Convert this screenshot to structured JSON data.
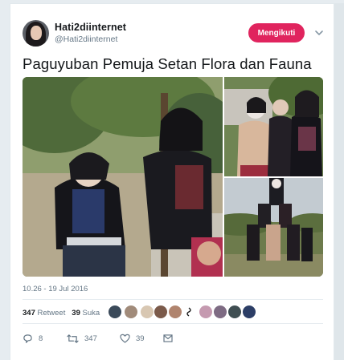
{
  "user": {
    "display_name": "Hati2diinternet",
    "handle": "@Hati2diinternet"
  },
  "follow_button": {
    "label": "Mengikuti",
    "color": "#e0245e"
  },
  "tweet": {
    "text": "Paguyuban Pemuja Setan Flora dan Fauna",
    "timestamp": "10.26 - 19 Jul 2016"
  },
  "stats": {
    "retweets": "347",
    "retweet_label": "Retweet",
    "likes": "39",
    "likes_label": "Suka"
  },
  "actions": {
    "reply_count": "8",
    "retweet_count": "347",
    "like_count": "39"
  },
  "icons": [
    "caret-down-icon",
    "reply-icon",
    "retweet-icon",
    "like-icon",
    "message-icon"
  ],
  "colors": {
    "accent": "#e0245e",
    "secondary_text": "#657786",
    "background": "#e6ecf0"
  }
}
